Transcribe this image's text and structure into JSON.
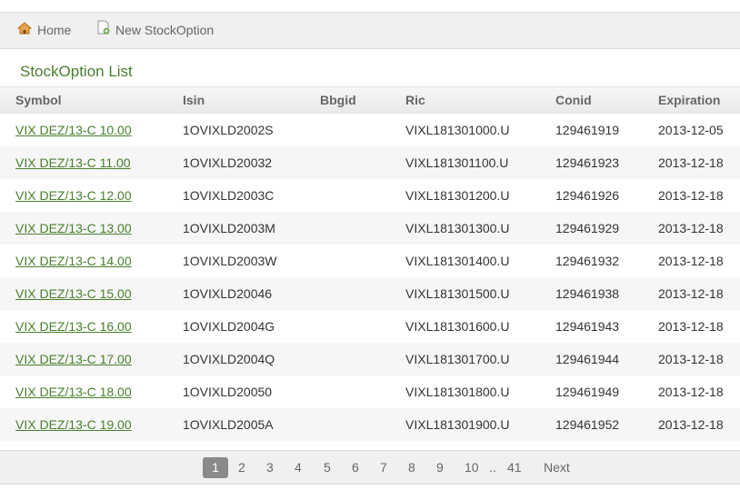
{
  "nav": {
    "home_label": "Home",
    "new_label": "New StockOption"
  },
  "page_title": "StockOption List",
  "table": {
    "headers": [
      "Symbol",
      "Isin",
      "Bbgid",
      "Ric",
      "Conid",
      "Expiration"
    ],
    "rows": [
      {
        "symbol": "VIX DEZ/13-C 10.00",
        "isin": "1OVIXLD2002S",
        "bbgid": "",
        "ric": "VIXL181301000.U",
        "conid": "129461919",
        "expiration": "2013-12-05"
      },
      {
        "symbol": "VIX DEZ/13-C 11.00",
        "isin": "1OVIXLD20032",
        "bbgid": "",
        "ric": "VIXL181301100.U",
        "conid": "129461923",
        "expiration": "2013-12-18"
      },
      {
        "symbol": "VIX DEZ/13-C 12.00",
        "isin": "1OVIXLD2003C",
        "bbgid": "",
        "ric": "VIXL181301200.U",
        "conid": "129461926",
        "expiration": "2013-12-18"
      },
      {
        "symbol": "VIX DEZ/13-C 13.00",
        "isin": "1OVIXLD2003M",
        "bbgid": "",
        "ric": "VIXL181301300.U",
        "conid": "129461929",
        "expiration": "2013-12-18"
      },
      {
        "symbol": "VIX DEZ/13-C 14.00",
        "isin": "1OVIXLD2003W",
        "bbgid": "",
        "ric": "VIXL181301400.U",
        "conid": "129461932",
        "expiration": "2013-12-18"
      },
      {
        "symbol": "VIX DEZ/13-C 15.00",
        "isin": "1OVIXLD20046",
        "bbgid": "",
        "ric": "VIXL181301500.U",
        "conid": "129461938",
        "expiration": "2013-12-18"
      },
      {
        "symbol": "VIX DEZ/13-C 16.00",
        "isin": "1OVIXLD2004G",
        "bbgid": "",
        "ric": "VIXL181301600.U",
        "conid": "129461943",
        "expiration": "2013-12-18"
      },
      {
        "symbol": "VIX DEZ/13-C 17.00",
        "isin": "1OVIXLD2004Q",
        "bbgid": "",
        "ric": "VIXL181301700.U",
        "conid": "129461944",
        "expiration": "2013-12-18"
      },
      {
        "symbol": "VIX DEZ/13-C 18.00",
        "isin": "1OVIXLD20050",
        "bbgid": "",
        "ric": "VIXL181301800.U",
        "conid": "129461949",
        "expiration": "2013-12-18"
      },
      {
        "symbol": "VIX DEZ/13-C 19.00",
        "isin": "1OVIXLD2005A",
        "bbgid": "",
        "ric": "VIXL181301900.U",
        "conid": "129461952",
        "expiration": "2013-12-18"
      }
    ]
  },
  "pagination": {
    "current": "1",
    "pages": [
      "2",
      "3",
      "4",
      "5",
      "6",
      "7",
      "8",
      "9",
      "10"
    ],
    "ellipsis": "..",
    "last": "41",
    "next_label": "Next"
  },
  "icons": {
    "home": "home-icon",
    "new": "new-document-icon"
  },
  "colors": {
    "link": "#48802c",
    "title": "#48802c",
    "current_page_bg": "#8a8a8a"
  }
}
